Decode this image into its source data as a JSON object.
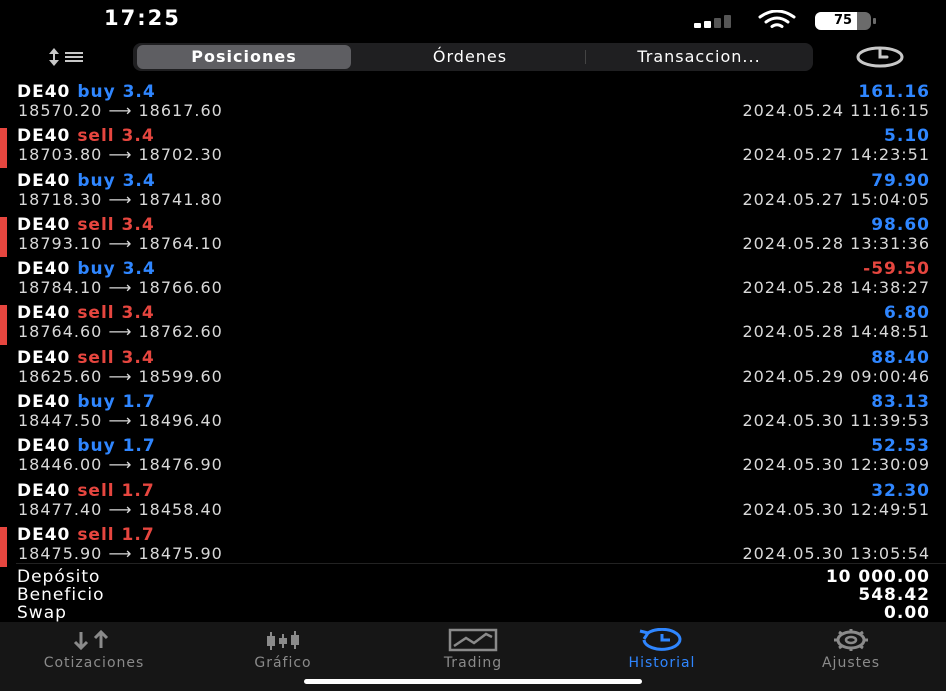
{
  "status_bar": {
    "time": "17:25",
    "battery_level": "75",
    "battery_fraction": 0.75
  },
  "tabs_top": [
    {
      "label": "Posiciones",
      "active": true
    },
    {
      "label": "Órdenes",
      "active": false
    },
    {
      "label": "Transaccion...",
      "active": false
    }
  ],
  "deals": [
    {
      "symbol": "DE40",
      "side": "buy",
      "volume": "3.4",
      "open": "18570.20",
      "close": "18617.60",
      "profit": "161.16",
      "time": "2024.05.24 11:16:15",
      "marker": false
    },
    {
      "symbol": "DE40",
      "side": "sell",
      "volume": "3.4",
      "open": "18703.80",
      "close": "18702.30",
      "profit": "5.10",
      "time": "2024.05.27 14:23:51",
      "marker": true
    },
    {
      "symbol": "DE40",
      "side": "buy",
      "volume": "3.4",
      "open": "18718.30",
      "close": "18741.80",
      "profit": "79.90",
      "time": "2024.05.27 15:04:05",
      "marker": false
    },
    {
      "symbol": "DE40",
      "side": "sell",
      "volume": "3.4",
      "open": "18793.10",
      "close": "18764.10",
      "profit": "98.60",
      "time": "2024.05.28 13:31:36",
      "marker": true
    },
    {
      "symbol": "DE40",
      "side": "buy",
      "volume": "3.4",
      "open": "18784.10",
      "close": "18766.60",
      "profit": "-59.50",
      "time": "2024.05.28 14:38:27",
      "marker": false
    },
    {
      "symbol": "DE40",
      "side": "sell",
      "volume": "3.4",
      "open": "18764.60",
      "close": "18762.60",
      "profit": "6.80",
      "time": "2024.05.28 14:48:51",
      "marker": true
    },
    {
      "symbol": "DE40",
      "side": "sell",
      "volume": "3.4",
      "open": "18625.60",
      "close": "18599.60",
      "profit": "88.40",
      "time": "2024.05.29 09:00:46",
      "marker": false
    },
    {
      "symbol": "DE40",
      "side": "buy",
      "volume": "1.7",
      "open": "18447.50",
      "close": "18496.40",
      "profit": "83.13",
      "time": "2024.05.30 11:39:53",
      "marker": false
    },
    {
      "symbol": "DE40",
      "side": "buy",
      "volume": "1.7",
      "open": "18446.00",
      "close": "18476.90",
      "profit": "52.53",
      "time": "2024.05.30 12:30:09",
      "marker": false
    },
    {
      "symbol": "DE40",
      "side": "sell",
      "volume": "1.7",
      "open": "18477.40",
      "close": "18458.40",
      "profit": "32.30",
      "time": "2024.05.30 12:49:51",
      "marker": false
    },
    {
      "symbol": "DE40",
      "side": "sell",
      "volume": "1.7",
      "open": "18475.90",
      "close": "18475.90",
      "profit": "",
      "time": "2024.05.30 13:05:54",
      "marker": true
    }
  ],
  "arrow_glyph": "⟶",
  "summary": [
    {
      "label": "Depósito",
      "value": "10 000.00"
    },
    {
      "label": "Beneficio",
      "value": "548.42"
    },
    {
      "label": "Swap",
      "value": "0.00"
    }
  ],
  "bottom_tabs": [
    {
      "label": "Cotizaciones",
      "icon": "quotes-arrows-icon",
      "active": false
    },
    {
      "label": "Gráfico",
      "icon": "candlestick-chart-icon",
      "active": false
    },
    {
      "label": "Trading",
      "icon": "trading-chart-icon",
      "active": false
    },
    {
      "label": "Historial",
      "icon": "history-clock-icon",
      "active": true
    },
    {
      "label": "Ajustes",
      "icon": "gear-icon",
      "active": false
    }
  ],
  "colors": {
    "buy": "#2f86ff",
    "sell": "#e6463f",
    "background": "#000000",
    "active_tab": "#2f86ff"
  }
}
